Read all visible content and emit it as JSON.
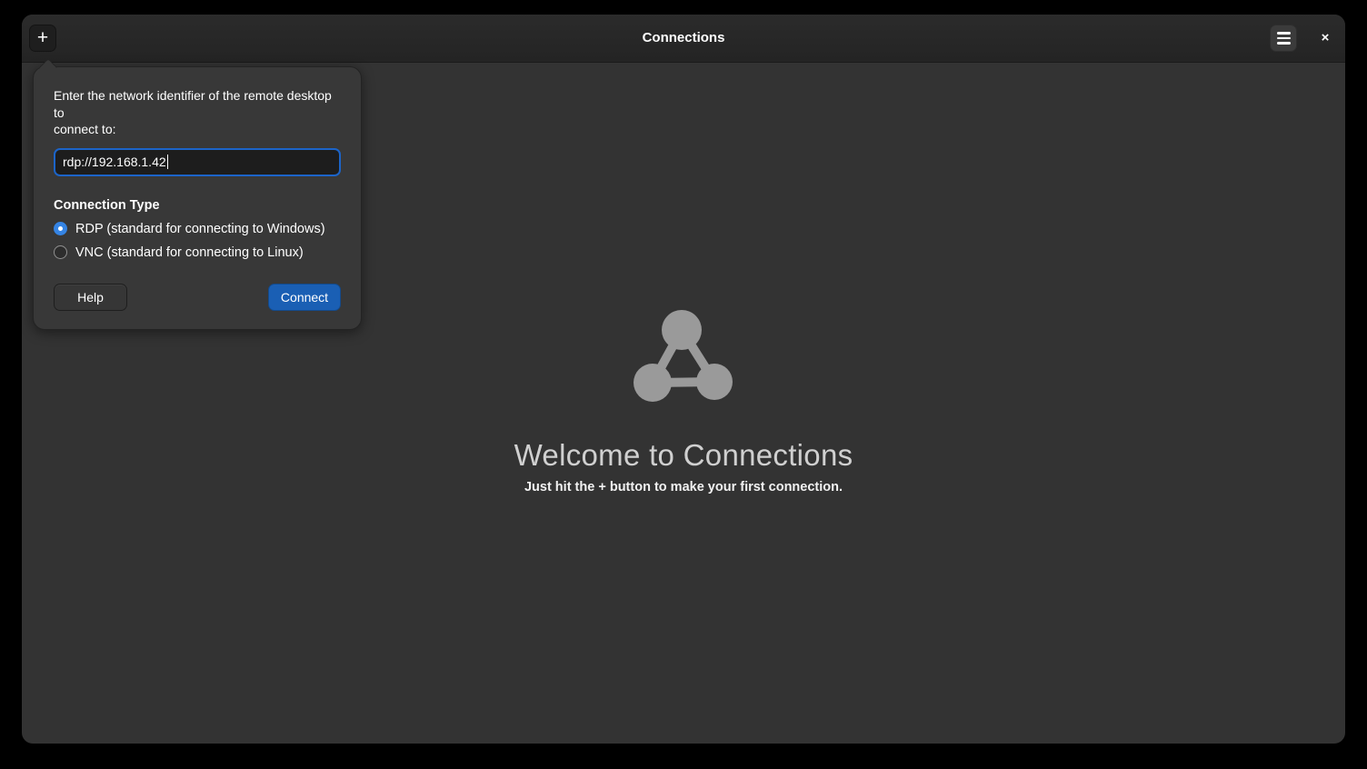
{
  "window": {
    "title": "Connections"
  },
  "header": {
    "add_button": {
      "icon": "plus",
      "glyph": "+"
    },
    "menu_button": {
      "icon": "hamburger-menu"
    },
    "close_button": {
      "icon": "close",
      "glyph": "×"
    }
  },
  "popover": {
    "prompt_lines": [
      "Enter the network identifier of the remote desktop to",
      "connect to:"
    ],
    "address_field": {
      "value": "rdp://192.168.1.42"
    },
    "section_title": "Connection Type",
    "options": [
      {
        "label": "RDP (standard for connecting to Windows)",
        "selected": true
      },
      {
        "label": "VNC (standard for connecting to Linux)",
        "selected": false
      }
    ],
    "buttons": {
      "help": "Help",
      "connect": "Connect"
    }
  },
  "empty_state": {
    "icon": "network-triangle",
    "title": "Welcome to Connections",
    "subtitle_prefix": "Just hit the ",
    "subtitle_plus": "+",
    "subtitle_suffix": " button to make your first connection."
  },
  "colors": {
    "accent_blue": "#1a5fb4",
    "radio_selected_blue": "#3584e4",
    "focus_ring_blue": "#1c64c8",
    "empty_icon_gray": "#9a9a9a",
    "window_bg": "#333333",
    "header_bg": "#262626",
    "popover_bg": "#383838"
  }
}
